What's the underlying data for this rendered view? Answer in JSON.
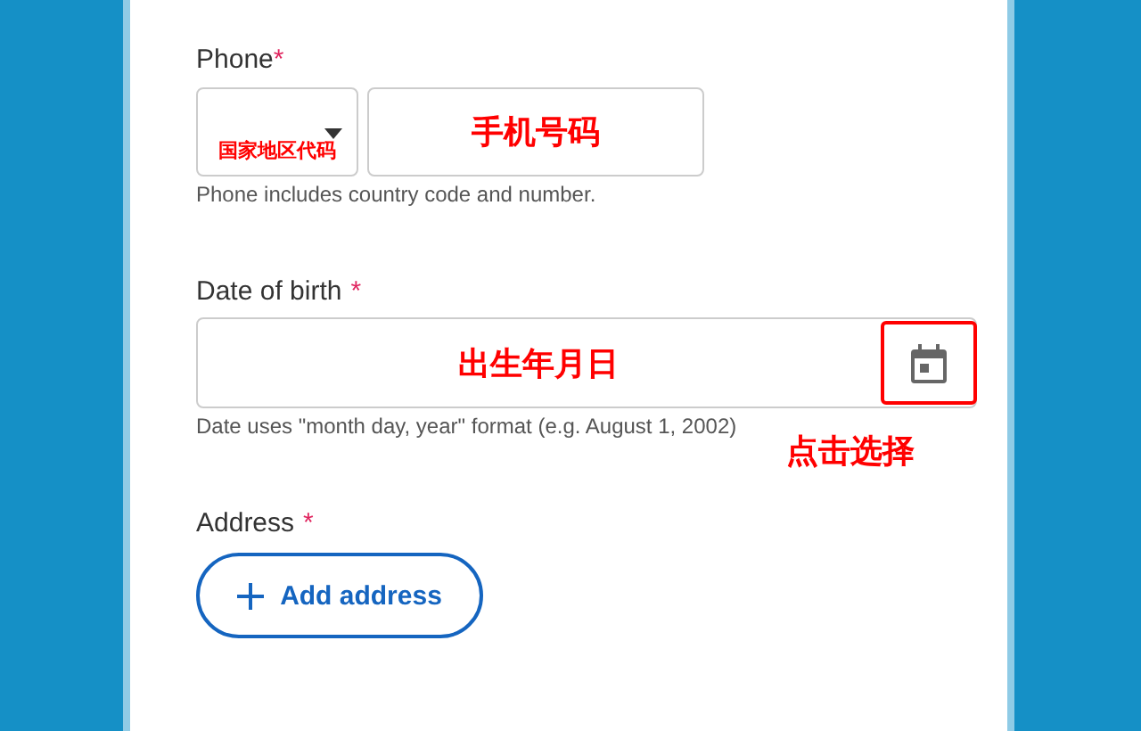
{
  "phone": {
    "label": "Phone",
    "required_mark": "*",
    "country_annotation": "国家地区代码",
    "number_annotation": "手机号码",
    "help": "Phone includes country code and number."
  },
  "date_of_birth": {
    "label": "Date of birth",
    "required_mark": "*",
    "annotation": "出生年月日",
    "help": "Date uses \"month day, year\" format (e.g. August 1, 2002)",
    "picker_annotation": "点击选择"
  },
  "address": {
    "label": "Address",
    "required_mark": "*",
    "button": "Add address"
  }
}
